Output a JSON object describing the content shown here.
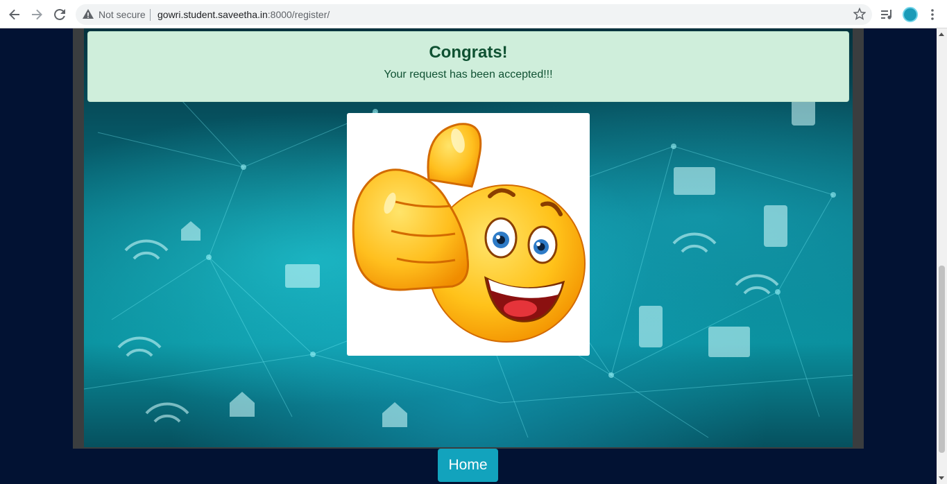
{
  "browser": {
    "security_label": "Not secure",
    "url_host": "gowri.student.saveetha.in",
    "url_path": ":8000/register/",
    "icons": [
      "back-icon",
      "forward-icon",
      "reload-icon",
      "warning-icon",
      "star-icon",
      "media-icon",
      "avatar",
      "kebab-menu-icon"
    ]
  },
  "alert": {
    "title": "Congrats!",
    "message": "Your request has been accepted!!!"
  },
  "image": {
    "description_icon": "thumbs-up-smiley"
  },
  "home_button": {
    "label": "Home"
  },
  "colors": {
    "page_bg": "#021233",
    "alert_bg": "#cfeedb",
    "alert_text": "#0f5132",
    "button_bg": "#12a3bd"
  }
}
